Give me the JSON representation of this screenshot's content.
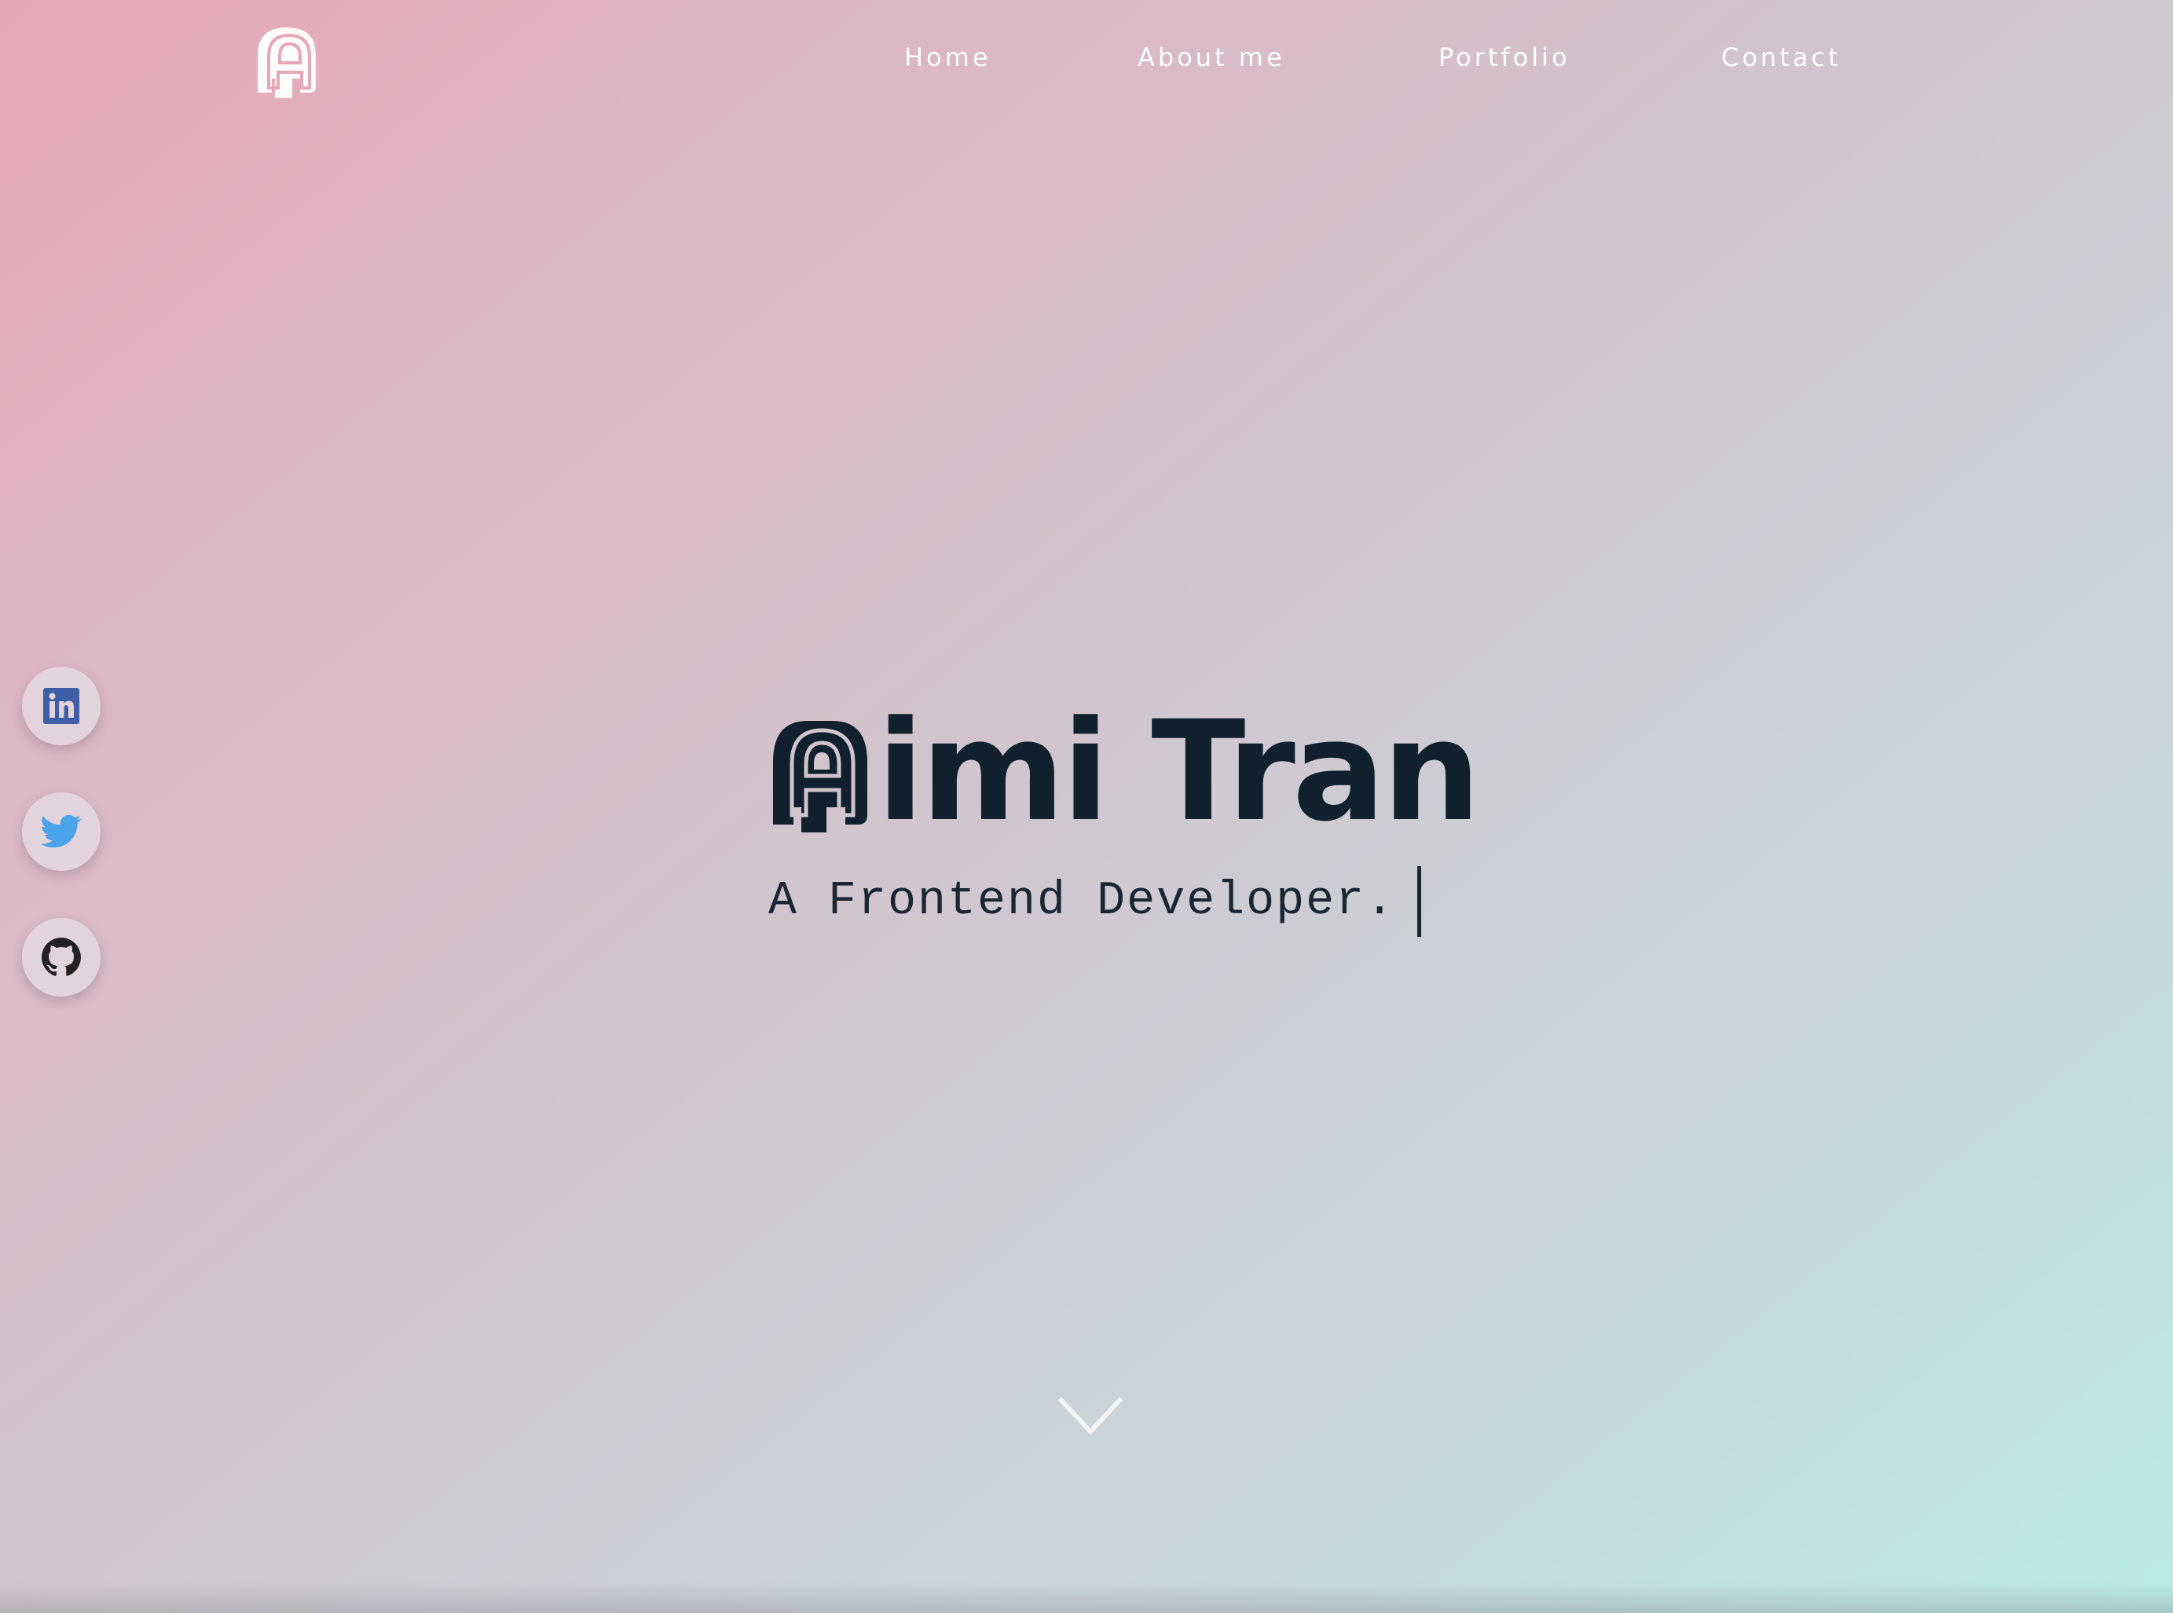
{
  "nav": {
    "items": [
      {
        "label": "Home"
      },
      {
        "label": "About me"
      },
      {
        "label": "Portfolio"
      },
      {
        "label": "Contact"
      }
    ]
  },
  "logo": {
    "icon": "stylized-letter-a-logo"
  },
  "social": [
    {
      "name": "LinkedIn",
      "icon": "linkedin-icon",
      "color": "#3f5ea8"
    },
    {
      "name": "Twitter",
      "icon": "twitter-icon",
      "color": "#4aa3e8"
    },
    {
      "name": "GitHub",
      "icon": "github-icon",
      "color": "#222222"
    }
  ],
  "hero": {
    "name": "imi Tran",
    "subtitle": "A Frontend Developer."
  },
  "scroll_icon": "chevron-down-icon",
  "colors": {
    "gradient_start": "#e6a8b6",
    "gradient_end": "#b9ebe6",
    "title": "#10202e",
    "nav_text": "#ffffff"
  }
}
